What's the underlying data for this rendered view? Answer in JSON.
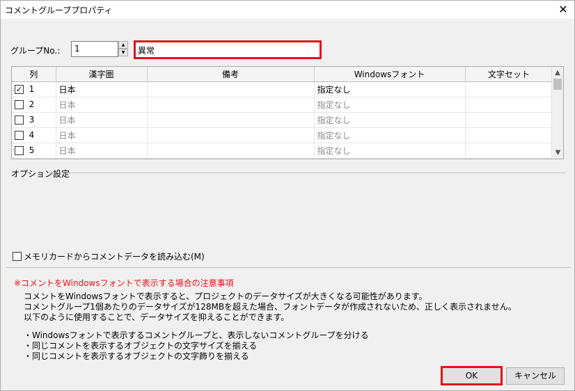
{
  "window": {
    "title": "コメントグループプロパティ",
    "close": "✕"
  },
  "group": {
    "label": "グループNo.:",
    "number": "1",
    "name": "異常"
  },
  "grid": {
    "columns": [
      "列",
      "漢字圏",
      "備考",
      "Windowsフォント",
      "文字セット"
    ],
    "rows": [
      {
        "checked": true,
        "col": "1",
        "kanji": "日本",
        "note": "",
        "font": "指定なし",
        "charset": ""
      },
      {
        "checked": false,
        "col": "2",
        "kanji": "日本",
        "note": "",
        "font": "指定なし",
        "charset": ""
      },
      {
        "checked": false,
        "col": "3",
        "kanji": "日本",
        "note": "",
        "font": "指定なし",
        "charset": ""
      },
      {
        "checked": false,
        "col": "4",
        "kanji": "日本",
        "note": "",
        "font": "指定なし",
        "charset": ""
      },
      {
        "checked": false,
        "col": "5",
        "kanji": "日本",
        "note": "",
        "font": "指定なし",
        "charset": ""
      }
    ]
  },
  "options": {
    "section_label": "オプション設定",
    "memcard_label": "メモリカードからコメントデータを読み込む(M)"
  },
  "notice": {
    "title": "※コメントをWindowsフォントで表示する場合の注意事項",
    "lines": [
      "コメントをWindowsフォントで表示すると、プロジェクトのデータサイズが大きくなる可能性があります。",
      "コメントグループ1個あたりのデータサイズが128MBを超えた場合、フォントデータが作成されないため、正しく表示されません。",
      "以下のように使用することで、データサイズを抑えることができます。"
    ],
    "bullets": [
      "・Windowsフォントで表示するコメントグループと、表示しないコメントグループを分ける",
      "・同じコメントを表示するオブジェクトの文字サイズを揃える",
      "・同じコメントを表示するオブジェクトの文字飾りを揃える"
    ]
  },
  "buttons": {
    "ok": "OK",
    "cancel": "キャンセル"
  },
  "colors": {
    "highlight": "#e3121c",
    "dim_text": "#8a8a8a"
  }
}
